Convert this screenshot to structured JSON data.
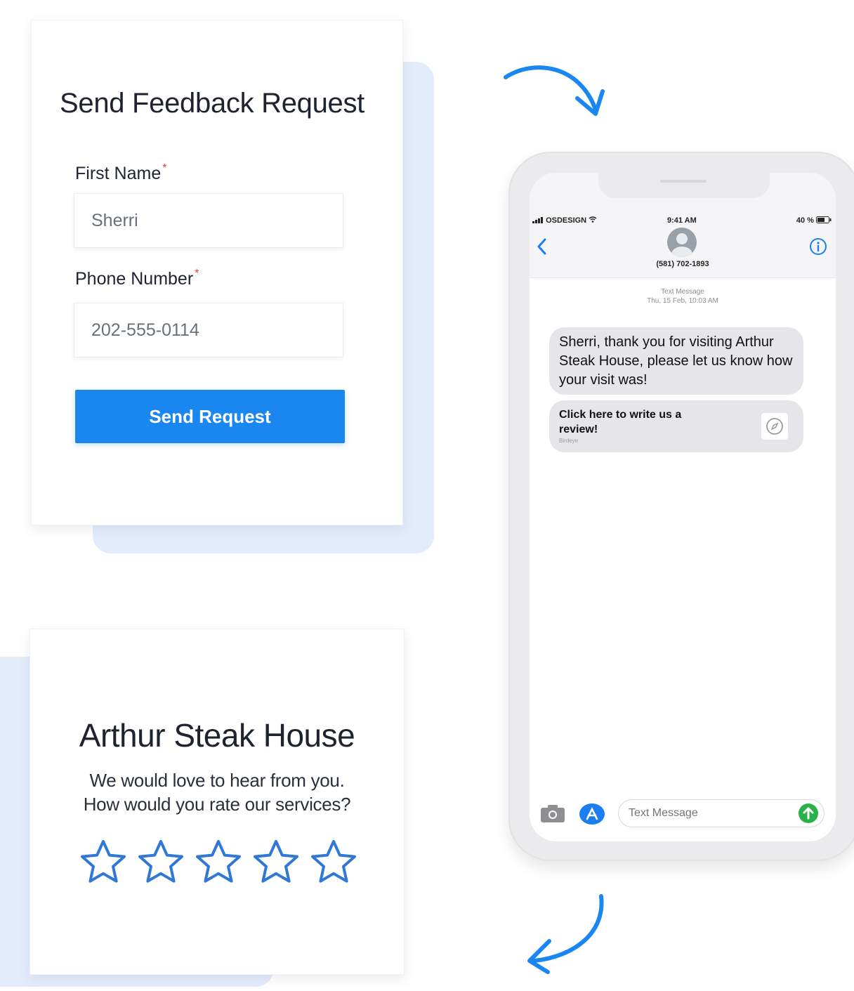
{
  "form": {
    "title": "Send Feedback Request",
    "first_name_label": "First Name",
    "first_name_value": "Sherri",
    "phone_label": "Phone Number",
    "phone_value": "202-555-0114",
    "required_mark": "*",
    "submit_label": "Send Request"
  },
  "review": {
    "title": "Arthur Steak House",
    "line1": "We would love to hear from you.",
    "line2": "How would you rate our services?",
    "star_count": 5,
    "selected_rating": 0
  },
  "phone": {
    "carrier": "OSDESIGN",
    "time": "9:41 AM",
    "battery": "40 %",
    "contact_number": "(581) 702-1893",
    "message_kind": "Text Message",
    "message_time": "Thu, 15 Feb, 10:03 AM",
    "message_text": "Sherri, thank you for visiting Arthur Steak House, please let us know how your visit was!",
    "link_title": "Click here to write us a review!",
    "link_sub": "Birdeye",
    "input_placeholder": "Text Message"
  },
  "colors": {
    "accent": "#1a86f0",
    "star_outline": "#2f78d6",
    "shadow_block": "#e3ecfa",
    "required": "#e23b3b",
    "bubble": "#e5e5ea",
    "ios_blue": "#1a7ef0",
    "send_green": "#2ab24a"
  },
  "icons": {
    "arrows": [
      "curved-arrow-right-down-icon",
      "curved-arrow-left-down-icon"
    ],
    "phone": [
      "signal-icon",
      "wifi-icon",
      "battery-icon",
      "back-chevron-icon",
      "contact-avatar-icon",
      "info-icon",
      "compass-icon",
      "camera-icon",
      "app-store-icon",
      "send-arrow-icon"
    ]
  }
}
